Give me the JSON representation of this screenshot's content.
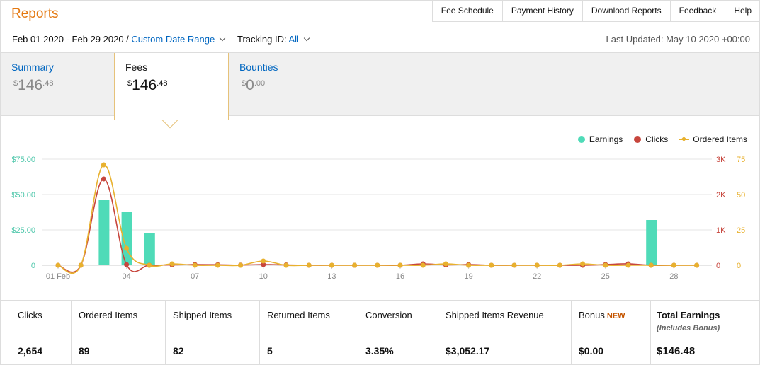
{
  "header": {
    "title": "Reports",
    "nav": [
      "Fee Schedule",
      "Payment History",
      "Download Reports",
      "Feedback",
      "Help"
    ]
  },
  "filters": {
    "date_range": "Feb 01 2020 - Feb 29 2020 /",
    "date_range_link": "Custom Date Range",
    "tracking_label": "Tracking ID:",
    "tracking_value": "All",
    "last_updated": "Last Updated: May 10 2020 +00:00"
  },
  "tabs": [
    {
      "label": "Summary",
      "currency": "$",
      "whole": "146",
      "cents": ".48"
    },
    {
      "label": "Fees",
      "currency": "$",
      "whole": "146",
      "cents": ".48"
    },
    {
      "label": "Bounties",
      "currency": "$",
      "whole": "0",
      "cents": ".00"
    }
  ],
  "legend": {
    "earnings": "Earnings",
    "clicks": "Clicks",
    "ordered": "Ordered Items"
  },
  "colors": {
    "accent": "#e47911",
    "link": "#0066c0",
    "earnings": "#4fdbb8",
    "clicks": "#c7463d",
    "ordered": "#e8b12e"
  },
  "chart_data": {
    "type": "bar",
    "x": [
      "01 Feb",
      "02",
      "03",
      "04",
      "05",
      "06",
      "07",
      "08",
      "09",
      "10",
      "11",
      "12",
      "13",
      "14",
      "15",
      "16",
      "17",
      "18",
      "19",
      "20",
      "21",
      "22",
      "23",
      "24",
      "25",
      "26",
      "27",
      "28",
      "29"
    ],
    "x_tick_labels": [
      "01 Feb",
      "04",
      "07",
      "10",
      "13",
      "16",
      "19",
      "22",
      "25",
      "28"
    ],
    "series": [
      {
        "name": "Earnings",
        "type": "bar",
        "axis": "left",
        "values": [
          0,
          0,
          46,
          38,
          23,
          0,
          0,
          0,
          0,
          0,
          0,
          0,
          0,
          0,
          0,
          0,
          0,
          0,
          0,
          0,
          0,
          0,
          0,
          0,
          0,
          0,
          32,
          0,
          0
        ]
      },
      {
        "name": "Clicks",
        "type": "line",
        "axis": "right1",
        "values": [
          0,
          0,
          2440,
          20,
          0,
          10,
          20,
          15,
          5,
          20,
          10,
          0,
          0,
          0,
          0,
          0,
          40,
          10,
          20,
          0,
          0,
          0,
          0,
          0,
          20,
          40,
          0,
          0,
          0
        ]
      },
      {
        "name": "Ordered Items",
        "type": "line",
        "axis": "right2",
        "values": [
          0,
          0,
          71,
          12,
          0,
          1,
          0,
          0,
          0,
          3,
          0,
          0,
          0,
          0,
          0,
          0,
          0,
          1,
          0,
          0,
          0,
          0,
          0,
          1,
          0,
          0,
          0,
          0,
          0
        ]
      }
    ],
    "y_left": {
      "ticks": [
        "0",
        "$25.00",
        "$50.00",
        "$75.00"
      ],
      "range": [
        0,
        75
      ]
    },
    "y_right1": {
      "ticks": [
        "0",
        "1K",
        "2K",
        "3K"
      ],
      "range": [
        0,
        3000
      ]
    },
    "y_right2": {
      "ticks": [
        "0",
        "25",
        "50",
        "75"
      ],
      "range": [
        0,
        75
      ]
    }
  },
  "stats": [
    {
      "label": "Clicks",
      "value": "2,654"
    },
    {
      "label": "Ordered Items",
      "value": "89"
    },
    {
      "label": "Shipped Items",
      "value": "82"
    },
    {
      "label": "Returned Items",
      "value": "5"
    },
    {
      "label": "Conversion",
      "value": "3.35%"
    },
    {
      "label": "Shipped Items Revenue",
      "value": "$3,052.17"
    },
    {
      "label": "Bonus",
      "badge": "NEW",
      "value": "$0.00"
    },
    {
      "label": "Total Earnings",
      "sub": "(Includes Bonus)",
      "value": "$146.48"
    }
  ]
}
